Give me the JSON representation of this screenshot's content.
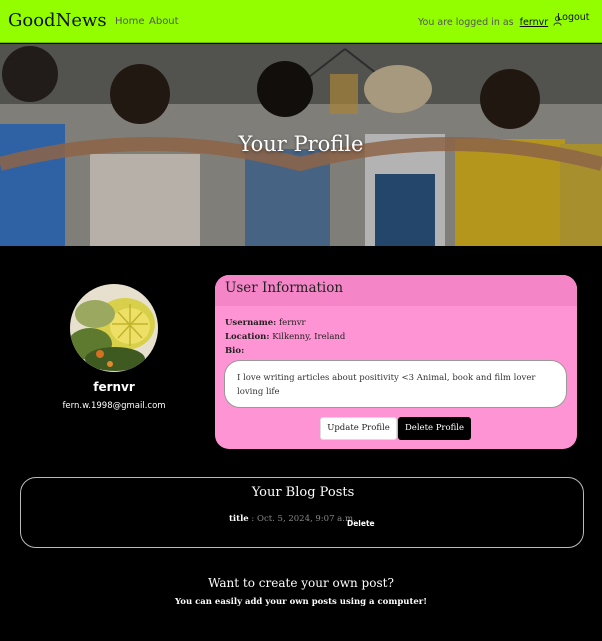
{
  "navbar": {
    "brand": "GoodNews",
    "links": [
      "Home",
      "About"
    ],
    "logged_in_text": "You are logged in as",
    "username": "fernvr",
    "logout_label": "Logout"
  },
  "hero": {
    "title": "Your Profile"
  },
  "profile": {
    "username": "fernvr",
    "email": "fern.w.1998@gmail.com"
  },
  "user_info": {
    "header": "User Information",
    "username_label": "Username:",
    "username_value": "fernvr",
    "location_label": "Location:",
    "location_value": "Kilkenny, Ireland",
    "bio_label": "Bio:",
    "bio_text": "I love writing articles about positivity <3 Animal, book and film lover loving life",
    "update_button": "Update Profile",
    "delete_button": "Delete Profile"
  },
  "blog_posts": {
    "title": "Your Blog Posts",
    "posts": [
      {
        "title": "title",
        "separator": " : ",
        "date": "Oct. 5, 2024, 9:07 a.m.",
        "delete_label": "Delete"
      }
    ]
  },
  "cta": {
    "title": "Want to create your own post?",
    "text": "You can easily add your own posts using a computer!"
  },
  "colors": {
    "navbar": "#92fe00",
    "card": "#ff94d4",
    "card_header": "#f486c8",
    "background": "#000000"
  },
  "icons": {
    "user": "user-icon"
  }
}
